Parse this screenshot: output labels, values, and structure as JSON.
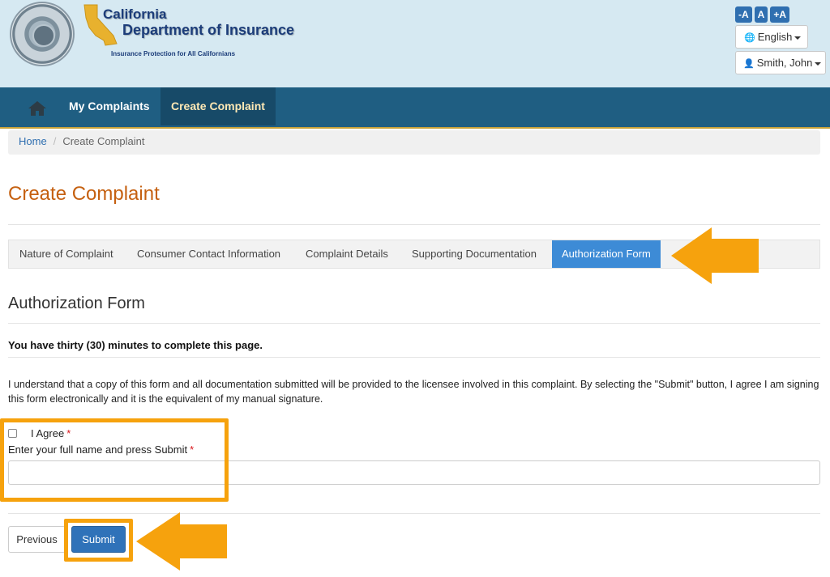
{
  "header": {
    "brand_line1": "California",
    "brand_line2": "Department of Insurance",
    "tagline": "Insurance Protection for All Californians",
    "font_controls": [
      "-A",
      "A",
      "+A"
    ],
    "language": "English",
    "user": "Smith, John"
  },
  "nav": {
    "items": [
      {
        "label": "My Complaints",
        "active": false
      },
      {
        "label": "Create Complaint",
        "active": true
      }
    ]
  },
  "breadcrumb": {
    "home": "Home",
    "current": "Create Complaint"
  },
  "page": {
    "title": "Create Complaint"
  },
  "tabs": [
    {
      "label": "Nature of Complaint",
      "active": false
    },
    {
      "label": "Consumer Contact Information",
      "active": false
    },
    {
      "label": "Complaint Details",
      "active": false
    },
    {
      "label": "Supporting Documentation",
      "active": false
    },
    {
      "label": "Authorization Form",
      "active": true
    }
  ],
  "form": {
    "section_title": "Authorization Form",
    "time_note": "You have thirty (30) minutes to complete this page.",
    "agreement_text": "I understand that a copy of this form and all documentation submitted will be provided to the licensee involved in this complaint. By selecting the \"Submit\" button, I agree I am signing this form electronically and it is the equivalent of my manual signature.",
    "agree_label": "I Agree",
    "agree_checked": false,
    "name_label": "Enter your full name and press Submit",
    "required_marker": "*",
    "name_value": ""
  },
  "actions": {
    "previous": "Previous",
    "submit": "Submit"
  },
  "colors": {
    "header_bg": "#d6e9f2",
    "navbar_bg": "#1f5e82",
    "title_orange": "#c56010",
    "active_tab": "#3d8bd6",
    "annotation": "#f6a20d"
  }
}
